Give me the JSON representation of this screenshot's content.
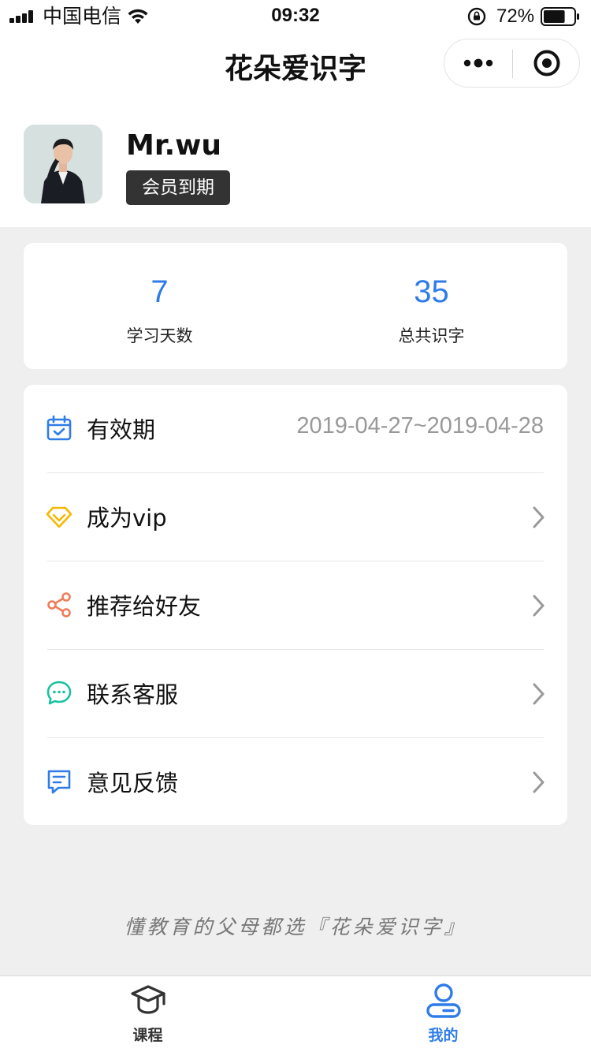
{
  "status_bar": {
    "carrier": "中国电信",
    "time": "09:32",
    "battery_percent": "72%",
    "battery_level": 0.72
  },
  "nav": {
    "title": "花朵爱识字"
  },
  "profile": {
    "username": "Mr.wu",
    "member_status": "会员到期"
  },
  "stats": [
    {
      "value": "7",
      "label": "学习天数"
    },
    {
      "value": "35",
      "label": "总共识字"
    }
  ],
  "menu": [
    {
      "icon": "calendar-icon",
      "label": "有效期",
      "value": "2019-04-27~2019-04-28",
      "color": "#2f7ce8"
    },
    {
      "icon": "diamond-icon",
      "label": "成为vip",
      "color": "#f5b800"
    },
    {
      "icon": "share-icon",
      "label": "推荐给好友",
      "color": "#f07c5a"
    },
    {
      "icon": "chat-icon",
      "label": "联系客服",
      "color": "#19c2a0"
    },
    {
      "icon": "feedback-icon",
      "label": "意见反馈",
      "color": "#2f7ce8"
    }
  ],
  "slogan": "懂教育的父母都选『花朵爱识字』",
  "tabs": [
    {
      "icon": "graduation-cap-icon",
      "label": "课程",
      "active": false
    },
    {
      "icon": "user-icon",
      "label": "我的",
      "active": true
    }
  ],
  "colors": {
    "accent": "#2f7ce8",
    "inactive_tab": "#333333",
    "background": "#efefef"
  }
}
